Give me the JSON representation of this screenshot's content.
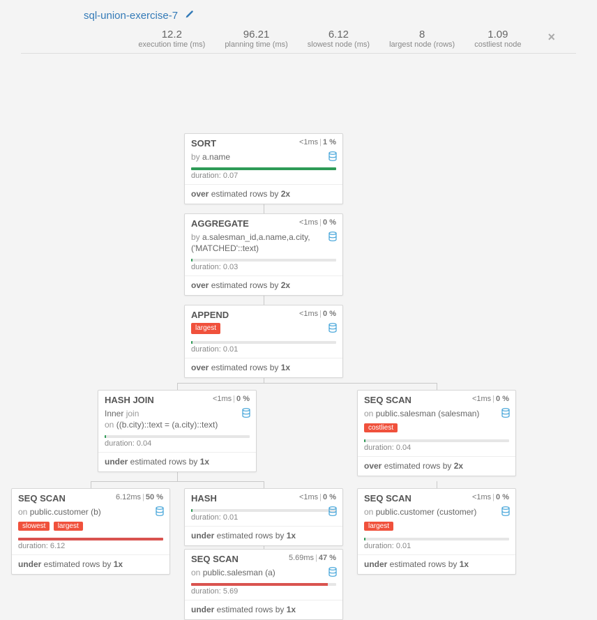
{
  "title": "sql-union-exercise-7",
  "stats": {
    "exec_value": "12.2",
    "exec_label": "execution time (ms)",
    "plan_value": "96.21",
    "plan_label": "planning time (ms)",
    "slow_value": "6.12",
    "slow_label": "slowest node (ms)",
    "large_value": "8",
    "large_label": "largest node (rows)",
    "cost_value": "1.09",
    "cost_label": "costliest node"
  },
  "labels": {
    "by": "by",
    "on": "on",
    "duration_prefix": "duration: ",
    "over": "over",
    "under": "under",
    "est_mid": " estimated rows by ",
    "slowest": "slowest",
    "largest": "largest",
    "costliest": "costliest",
    "lt1ms": "<1ms",
    "pct0": "0 %",
    "pct1": "1 %"
  },
  "nodes": {
    "sort": {
      "title": "SORT",
      "timing_a": "<1ms",
      "timing_b": "1 %",
      "sub": "a.name",
      "dur": "0.07",
      "est_dir": "over",
      "est_x": "2x",
      "bar_w": "2%"
    },
    "agg": {
      "title": "AGGREGATE",
      "timing_a": "<1ms",
      "timing_b": "0 %",
      "sub": "a.salesman_id,a.name,a.city,('MATCHED'::text)",
      "dur": "0.03",
      "est_dir": "over",
      "est_x": "2x",
      "bar_w": "1%"
    },
    "append": {
      "title": "APPEND",
      "timing_a": "<1ms",
      "timing_b": "0 %",
      "dur": "0.01",
      "est_dir": "over",
      "est_x": "1x",
      "bar_w": "1%"
    },
    "hashjoin": {
      "title": "HASH JOIN",
      "timing_a": "<1ms",
      "timing_b": "0 %",
      "sub_line1_a": "Inner",
      "sub_line1_b": " join",
      "sub_line2": "((b.city)::text = (a.city)::text)",
      "dur": "0.04",
      "est_dir": "under",
      "est_x": "1x",
      "bar_w": "1%"
    },
    "seq1": {
      "title": "SEQ SCAN",
      "timing_a": "<1ms",
      "timing_b": "0 %",
      "sub": "public.salesman (salesman)",
      "dur": "0.04",
      "est_dir": "over",
      "est_x": "2x",
      "bar_w": "1%"
    },
    "seq_cust_b": {
      "title": "SEQ SCAN",
      "timing_a": "6.12ms",
      "timing_b": "50 %",
      "sub": "public.customer (b)",
      "dur": "6.12",
      "est_dir": "under",
      "est_x": "1x",
      "bar_w": "100%"
    },
    "hash": {
      "title": "HASH",
      "timing_a": "<1ms",
      "timing_b": "0 %",
      "dur": "0.01",
      "est_dir": "under",
      "est_x": "1x",
      "bar_w": "1%"
    },
    "seq_cust_c": {
      "title": "SEQ SCAN",
      "timing_a": "<1ms",
      "timing_b": "0 %",
      "sub": "public.customer (customer)",
      "dur": "0.01",
      "est_dir": "under",
      "est_x": "1x",
      "bar_w": "1%"
    },
    "seq_sales_a": {
      "title": "SEQ SCAN",
      "timing_a": "5.69ms",
      "timing_b": "47 %",
      "sub": "public.salesman (a)",
      "dur": "5.69",
      "est_dir": "under",
      "est_x": "1x",
      "bar_w": "94%"
    }
  }
}
